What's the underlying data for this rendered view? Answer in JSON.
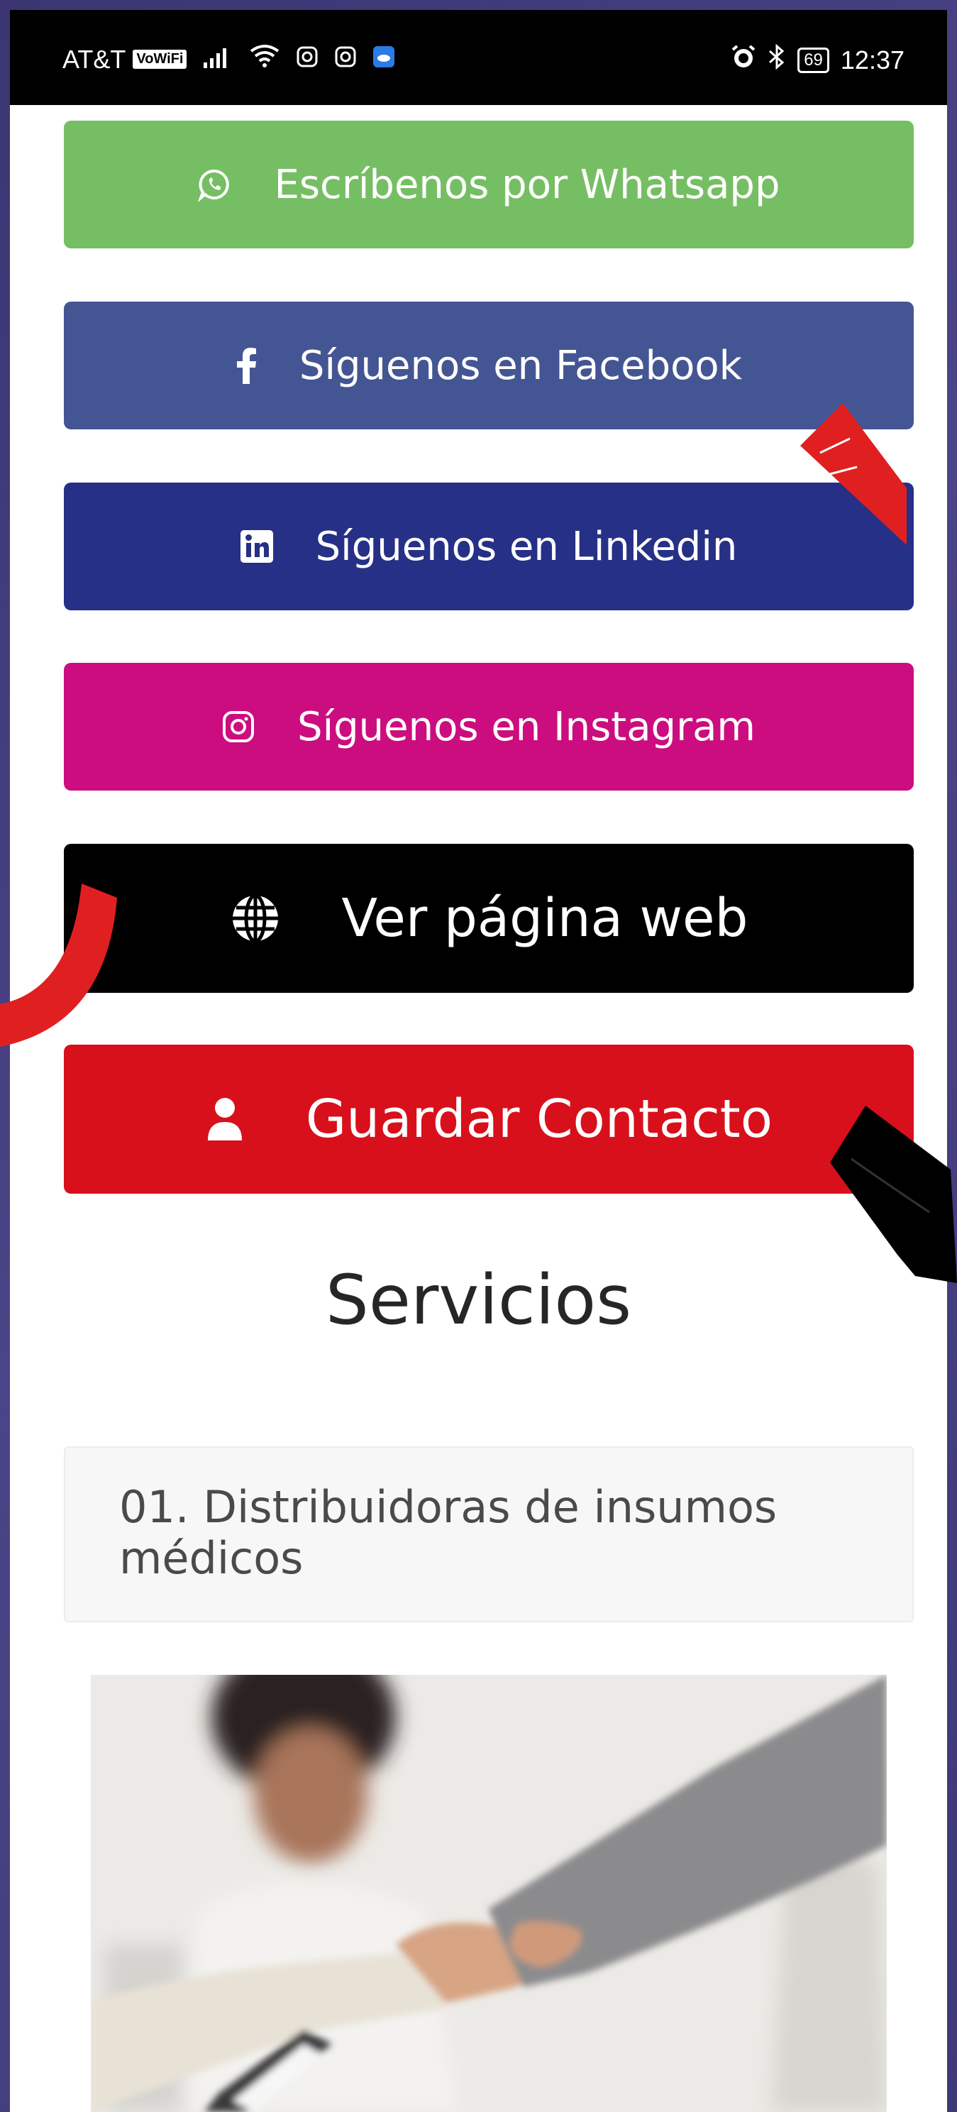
{
  "status_bar": {
    "carrier": "AT&T",
    "volte": "VoWiFi",
    "battery": "69",
    "time": "12:37"
  },
  "buttons": {
    "whatsapp": "Escríbenos por Whatsapp",
    "facebook": "Síguenos en Facebook",
    "linkedin": "Síguenos en Linkedin",
    "instagram": "Síguenos en Instagram",
    "website": "Ver página web",
    "save_contact": "Guardar Contacto"
  },
  "services": {
    "heading": "Servicios",
    "items": [
      {
        "label": "01. Distribuidoras de insumos médicos"
      }
    ]
  },
  "colors": {
    "whatsapp": "#76be63",
    "facebook": "#445593",
    "linkedin": "#263086",
    "instagram": "#cc0d7f",
    "website": "#000000",
    "save_contact": "#d8101b",
    "annotation_red": "#e02020",
    "annotation_black": "#000000"
  },
  "icons": {
    "whatsapp": "whatsapp-icon",
    "facebook": "facebook-icon",
    "linkedin": "linkedin-icon",
    "instagram": "instagram-icon",
    "website": "globe-icon",
    "save_contact": "user-icon"
  }
}
